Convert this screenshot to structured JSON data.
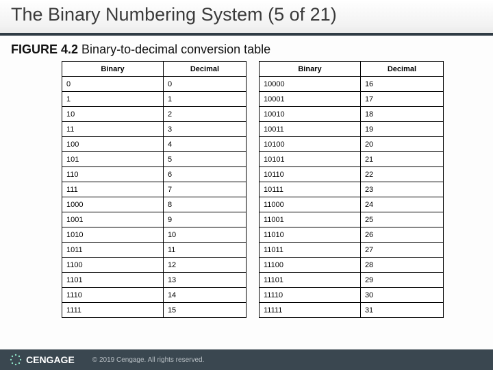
{
  "title": "The Binary Numbering System (5 of 21)",
  "figure": {
    "label": "FIGURE 4.2",
    "caption": "Binary-to-decimal conversion table"
  },
  "headers": {
    "binary": "Binary",
    "decimal": "Decimal"
  },
  "table_left": [
    {
      "bin": "0",
      "dec": "0"
    },
    {
      "bin": "1",
      "dec": "1"
    },
    {
      "bin": "10",
      "dec": "2"
    },
    {
      "bin": "11",
      "dec": "3"
    },
    {
      "bin": "100",
      "dec": "4"
    },
    {
      "bin": "101",
      "dec": "5"
    },
    {
      "bin": "110",
      "dec": "6"
    },
    {
      "bin": "111",
      "dec": "7"
    },
    {
      "bin": "1000",
      "dec": "8"
    },
    {
      "bin": "1001",
      "dec": "9"
    },
    {
      "bin": "1010",
      "dec": "10"
    },
    {
      "bin": "1011",
      "dec": "11"
    },
    {
      "bin": "1100",
      "dec": "12"
    },
    {
      "bin": "1101",
      "dec": "13"
    },
    {
      "bin": "1110",
      "dec": "14"
    },
    {
      "bin": "1111",
      "dec": "15"
    }
  ],
  "table_right": [
    {
      "bin": "10000",
      "dec": "16"
    },
    {
      "bin": "10001",
      "dec": "17"
    },
    {
      "bin": "10010",
      "dec": "18"
    },
    {
      "bin": "10011",
      "dec": "19"
    },
    {
      "bin": "10100",
      "dec": "20"
    },
    {
      "bin": "10101",
      "dec": "21"
    },
    {
      "bin": "10110",
      "dec": "22"
    },
    {
      "bin": "10111",
      "dec": "23"
    },
    {
      "bin": "11000",
      "dec": "24"
    },
    {
      "bin": "11001",
      "dec": "25"
    },
    {
      "bin": "11010",
      "dec": "26"
    },
    {
      "bin": "11011",
      "dec": "27"
    },
    {
      "bin": "11100",
      "dec": "28"
    },
    {
      "bin": "11101",
      "dec": "29"
    },
    {
      "bin": "11110",
      "dec": "30"
    },
    {
      "bin": "11111",
      "dec": "31"
    }
  ],
  "footer": {
    "brand": "CENGAGE",
    "copyright": "© 2019 Cengage. All rights reserved."
  }
}
